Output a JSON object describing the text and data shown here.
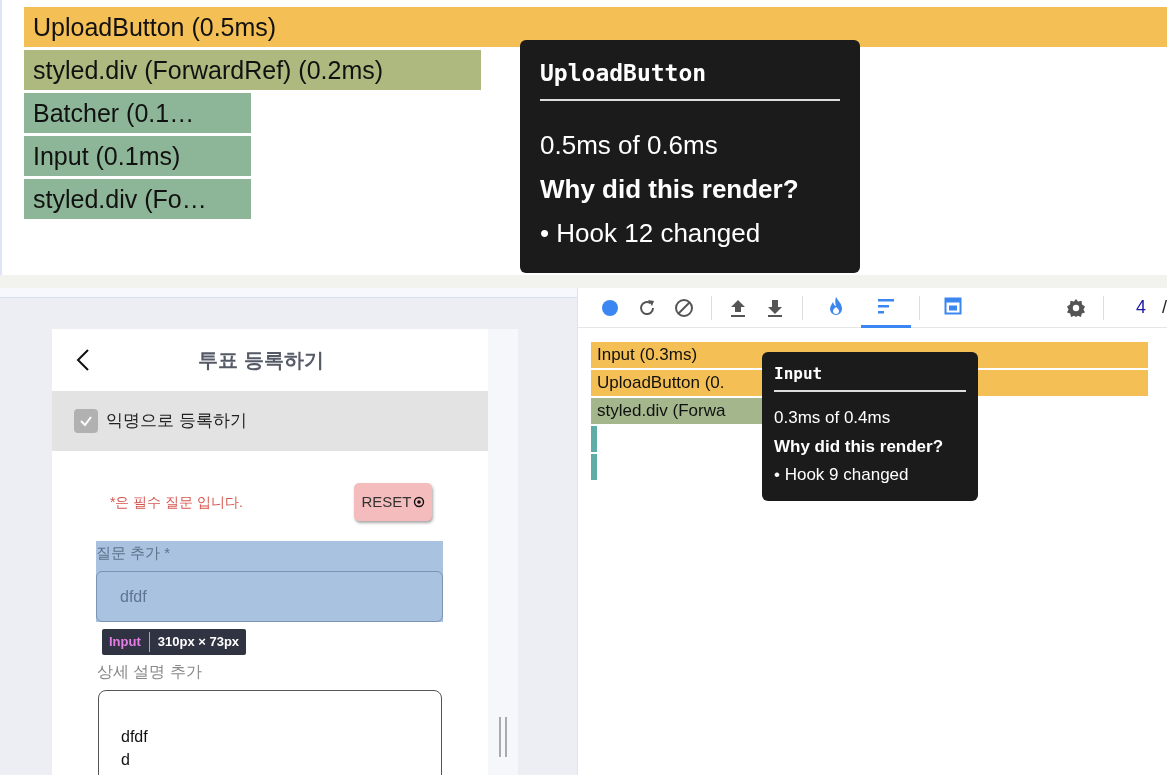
{
  "flame_top": {
    "bars": [
      {
        "label": "UploadButton (0.5ms)",
        "color": "#f4bf55"
      },
      {
        "label": "styled.div (ForwardRef) (0.2ms)",
        "color": "#adb97f"
      },
      {
        "label": "Batcher (0.1…",
        "color": "#8db597"
      },
      {
        "label": "Input (0.1ms)",
        "color": "#8db597"
      },
      {
        "label": "styled.div (Fo…",
        "color": "#8db597"
      }
    ]
  },
  "tooltip_top": {
    "title": "UploadButton",
    "duration": "0.5ms of 0.6ms",
    "heading": "Why did this render?",
    "reason": "• Hook 12 changed"
  },
  "app_preview": {
    "title": "투표 등록하기",
    "anonymous": {
      "label": "익명으로 등록하기",
      "checked": true
    },
    "required_note": "*은 필수 질문 입니다.",
    "reset_button": "RESET",
    "question": {
      "label": "질문 추가 *",
      "value": "dfdf",
      "highlighted": true
    },
    "inspector_tag": {
      "component": "Input",
      "size": "310px × 73px"
    },
    "description": {
      "label": "상세 설명 추가",
      "value": "dfdf\nd"
    }
  },
  "profiler": {
    "tabs": [
      {
        "kind": "flame",
        "selected": false
      },
      {
        "kind": "ranked",
        "selected": true
      },
      {
        "kind": "timeline",
        "selected": false
      }
    ],
    "commit": {
      "current": "4",
      "separator": "/"
    },
    "bars": [
      {
        "label": "Input (0.3ms)",
        "color": "#f4bf55"
      },
      {
        "label": "UploadButton (0.",
        "color": "#f4bf55"
      },
      {
        "label": "styled.div (Forwa",
        "color": "#a3b68c"
      },
      {
        "color": "#5fada6"
      },
      {
        "color": "#5fada6"
      }
    ],
    "tooltip": {
      "title": "Input",
      "duration": "0.3ms of 0.4ms",
      "heading": "Why did this render?",
      "reason": "• Hook 9 changed"
    }
  }
}
